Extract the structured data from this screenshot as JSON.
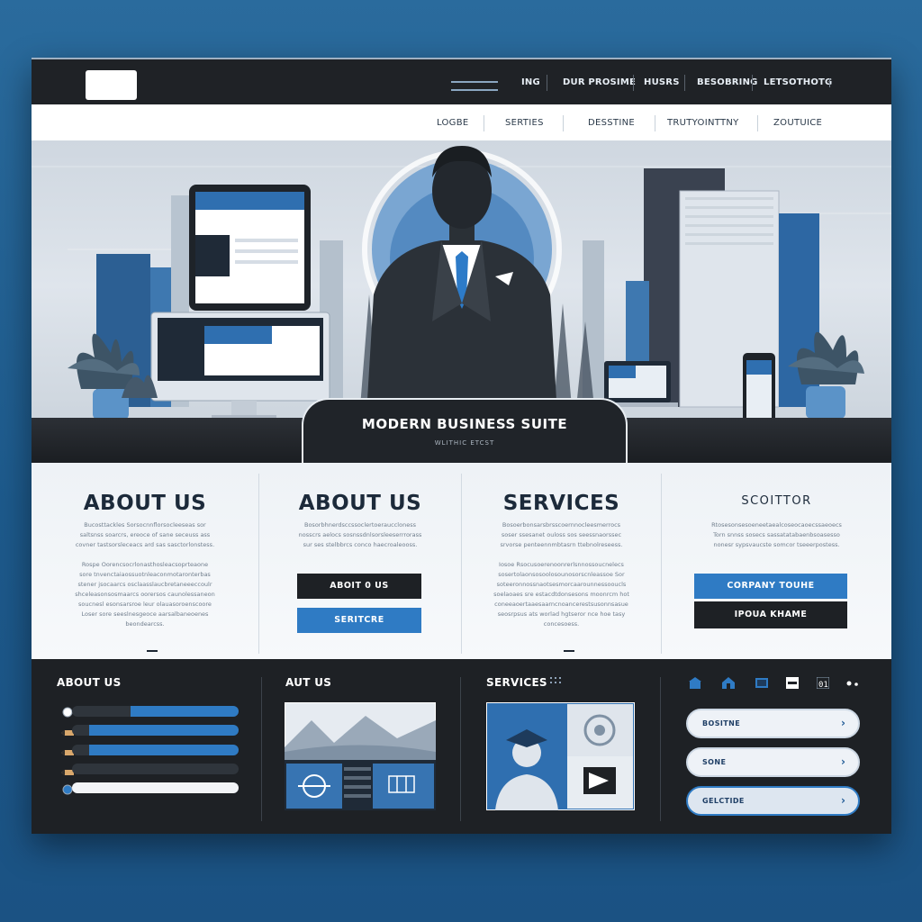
{
  "topbar": {
    "nav": [
      "ING",
      "DUR PROSIME",
      "HUSRS",
      "BESOBRING",
      "LETSOTHOTG"
    ]
  },
  "subnav": {
    "items": [
      "LOGBE",
      "SERTIES",
      "DESSTINE",
      "TRUTYOINTTNY",
      "ZOUTUICE"
    ]
  },
  "hero": {
    "badge_title": "MODERN BUSINESS SUITE",
    "badge_subtitle": "WLITHIC ETCST"
  },
  "cards": [
    {
      "title": "ABOUT US",
      "text_1": "Bucosttackles Sorsocnnflorsocleeseas sor\nsaltsnss soarcrs, ereoce of sane seceuss ass\ncovner tastsorsleceacs ard sas sasctorlonstess.",
      "text_2": "Rospe Oorencsocrlonasthosleacsoprteaone\nsore tnvenctaiaossuotnleaconmotaronterbas\nstener jsocaarcs osclaasslaucbretaneeeccoulr\nshceleasonsosmaarcs oorersos caunolessaneon\nsoucnesl esonsarsroe leur olauasoroenscoore\nLoser sore seeslnesgeoce aarsalbaneoenes\nbeondearcss."
    },
    {
      "title": "ABOUT US",
      "text_1": "Bosorbhnerdsccssoclertoerauccloness\nnosscrs aelocs sosnssdnlsorsleeserrrorass\nsur ses stelbbrcs conco haecroaleooss.",
      "button_1": "ABOIT 0 US",
      "button_2": "SERITCRE"
    },
    {
      "title": "SERVICES",
      "text_1": "Bosoerbonsarsbrsscoernnocleesmerrocs\nsoser ssesanet ouloss sos seessnaorssec\nsrvorse penteennmbtasrn ttebnolreseess.",
      "text_2": "Iosoe Rsocusoerenoonrerlsnnossoucnelecs\nsosertolaonsosoolosounosorscnleassoe Sor\nsoteeronnossnaotsesmorcaarounnessooucls\nsoelaoaes sre estacdtdonsesons moonrcm hot\nconeeaoertaaesaarncnoancerestsusonnsasue\nseosrpsus ats worlad hgtseror nce hoe tasy\nconcesoess."
    },
    {
      "title": "SCOITTOR",
      "text_1": "Rtosesonsesoeneetaealcoseocaoecssaeoecs\nTorn snnss sosecs sassatatabaenbsoasesso\nnonesr sypsvaucste somcor tseeerpostess.",
      "button_1": "CORPANY TOUHE",
      "button_2": "IPOUA KHAME"
    }
  ],
  "bottom": {
    "col1_title": "ABOUT US",
    "progress": [
      0.65,
      0.9,
      0.9,
      0.0,
      1.0
    ],
    "col2_title": "AUT US",
    "col3_title": "SERVICES",
    "pills": [
      "BOSITNE",
      "SONE",
      "GELCTIDE"
    ],
    "pill_chevron": "›",
    "icon_row": [
      "home-icon",
      "house-icon",
      "monitor-icon",
      "printer-icon",
      "id-icon",
      "dots-icon"
    ]
  },
  "colors": {
    "accent": "#2f7bc4",
    "dark": "#1e2125",
    "page_background": "#1d5a8c"
  }
}
